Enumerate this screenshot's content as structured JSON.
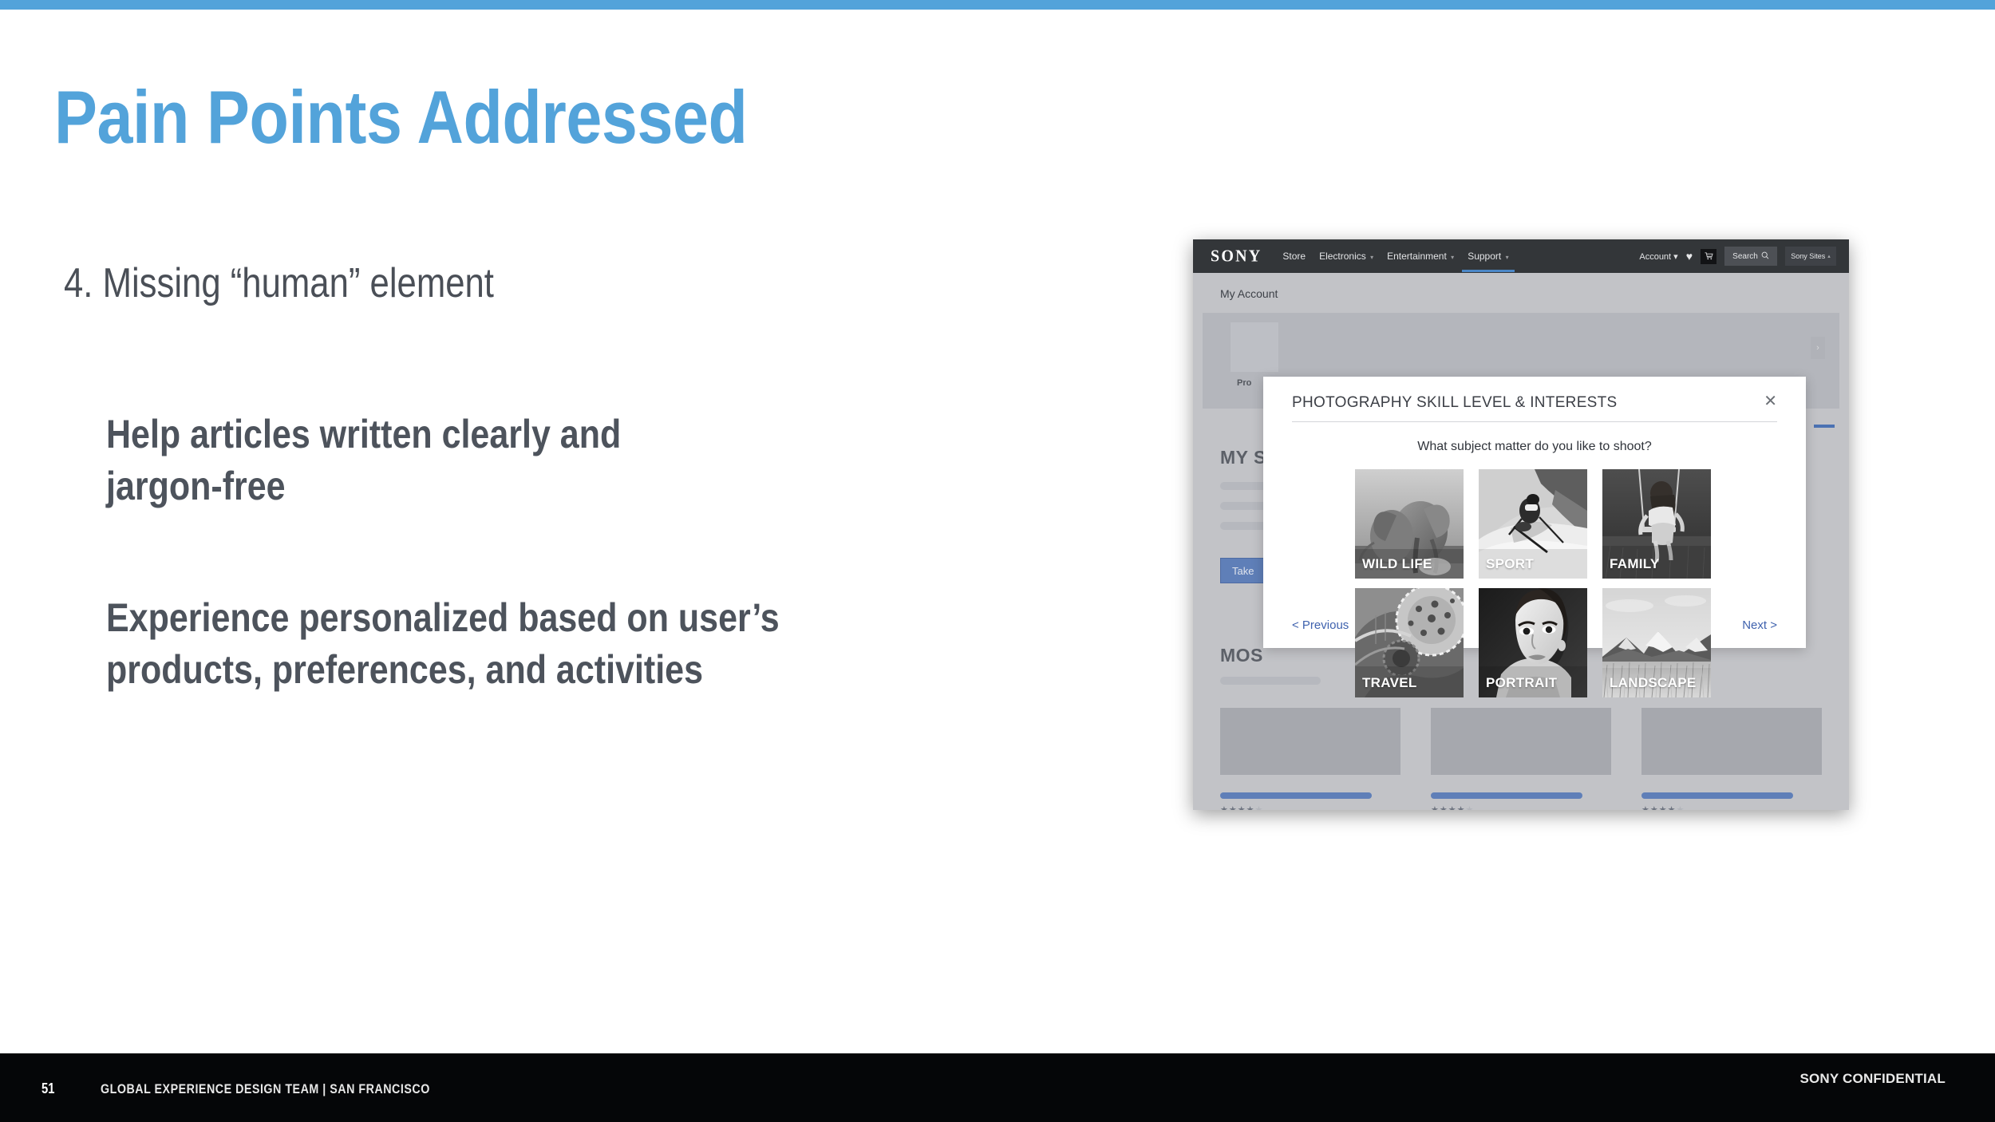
{
  "slide": {
    "title": "Pain Points Addressed",
    "subtitle": "4. Missing “human” element",
    "paragraph_1": [
      "Help articles written clearly and",
      "jargon-free"
    ],
    "paragraph_2": [
      "Experience personalized based on user’s",
      "products, preferences, and activities"
    ],
    "accent_color": "#53a3da",
    "body_text_color": "#4d535c"
  },
  "footer": {
    "page_number": "51",
    "team": "GLOBAL EXPERIENCE DESIGN TEAM | SAN FRANCISCO",
    "confidential": "SONY CONFIDENTIAL",
    "background": "#050608"
  },
  "mockup": {
    "nav": {
      "logo": "SONY",
      "links": [
        {
          "label": "Store",
          "caret": "",
          "active": false
        },
        {
          "label": "Electronics",
          "caret": "▾",
          "active": false
        },
        {
          "label": "Entertainment",
          "caret": "▾",
          "active": false
        },
        {
          "label": "Support",
          "caret": "▾",
          "active": true
        }
      ],
      "account": "Account ▾",
      "heart_icon": "♥",
      "cart_icon": "🛒",
      "search_label": "Search",
      "search_icon": "⚲",
      "sony_sites": "Sony Sites",
      "sony_sites_caret": "▴",
      "background": "#333639",
      "active_underline": "#4b87c7"
    },
    "page": {
      "breadcrumb": "My Account",
      "profile_label": "Pro",
      "section_my": "MY S",
      "section_most": "MOS",
      "take_button": "Take",
      "tab_icon": "›",
      "stars_filled": "★★★★",
      "stars_empty": "★",
      "background": "#c2c3c7"
    }
  },
  "modal": {
    "title": "PHOTOGRAPHY SKILL LEVEL & INTERESTS",
    "close_icon": "✕",
    "question": "What subject matter do you like to shoot?",
    "tiles": [
      {
        "label": "WILD LIFE",
        "subject": "elephants"
      },
      {
        "label": "SPORT",
        "subject": "skier"
      },
      {
        "label": "FAMILY",
        "subject": "child-on-swing"
      },
      {
        "label": "TRAVEL",
        "subject": "mosque-ceiling"
      },
      {
        "label": "PORTRAIT",
        "subject": "womans-face"
      },
      {
        "label": "LANDSCAPE",
        "subject": "mountain-field"
      }
    ],
    "previous": "<  Previous",
    "next": "Next  >",
    "link_color": "#3f62ae"
  }
}
